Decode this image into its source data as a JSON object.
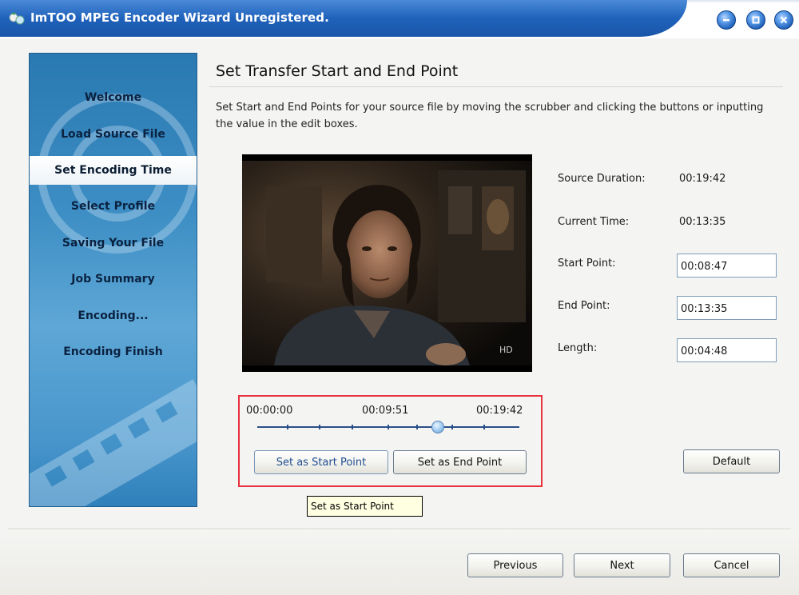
{
  "window": {
    "title": "ImTOO MPEG Encoder Wizard Unregistered."
  },
  "sidebar": {
    "items": [
      {
        "label": "Welcome"
      },
      {
        "label": "Load Source File"
      },
      {
        "label": "Set Encoding Time"
      },
      {
        "label": "Select Profile"
      },
      {
        "label": "Saving Your File"
      },
      {
        "label": "Job Summary"
      },
      {
        "label": "Encoding..."
      },
      {
        "label": "Encoding Finish"
      }
    ],
    "active_index": 2
  },
  "main": {
    "title": "Set Transfer Start and End Point",
    "description": "Set Start and End Points for your source file by moving the scrubber and clicking the buttons or inputting the value in the edit boxes.",
    "info": {
      "source_duration_label": "Source Duration:",
      "source_duration_value": "00:19:42",
      "current_time_label": "Current Time:",
      "current_time_value": "00:13:35",
      "start_point_label": "Start Point:",
      "start_point_value": "00:08:47",
      "end_point_label": "End Point:",
      "end_point_value": "00:13:35",
      "length_label": "Length:",
      "length_value": "00:04:48"
    },
    "video": {
      "watermark": "HD"
    },
    "scrubber": {
      "min_label": "00:00:00",
      "mid_label": "00:09:51",
      "max_label": "00:19:42",
      "position_fraction": 0.69
    },
    "buttons": {
      "set_start": "Set as Start Point",
      "set_end": "Set as End Point",
      "default": "Default"
    },
    "tooltip": "Set as Start Point"
  },
  "footer": {
    "previous": "Previous",
    "next": "Next",
    "cancel": "Cancel"
  },
  "colors": {
    "titlebar": "#1f62bb",
    "sidebar": "#3d8ec4",
    "highlight_box": "#e8323f"
  }
}
